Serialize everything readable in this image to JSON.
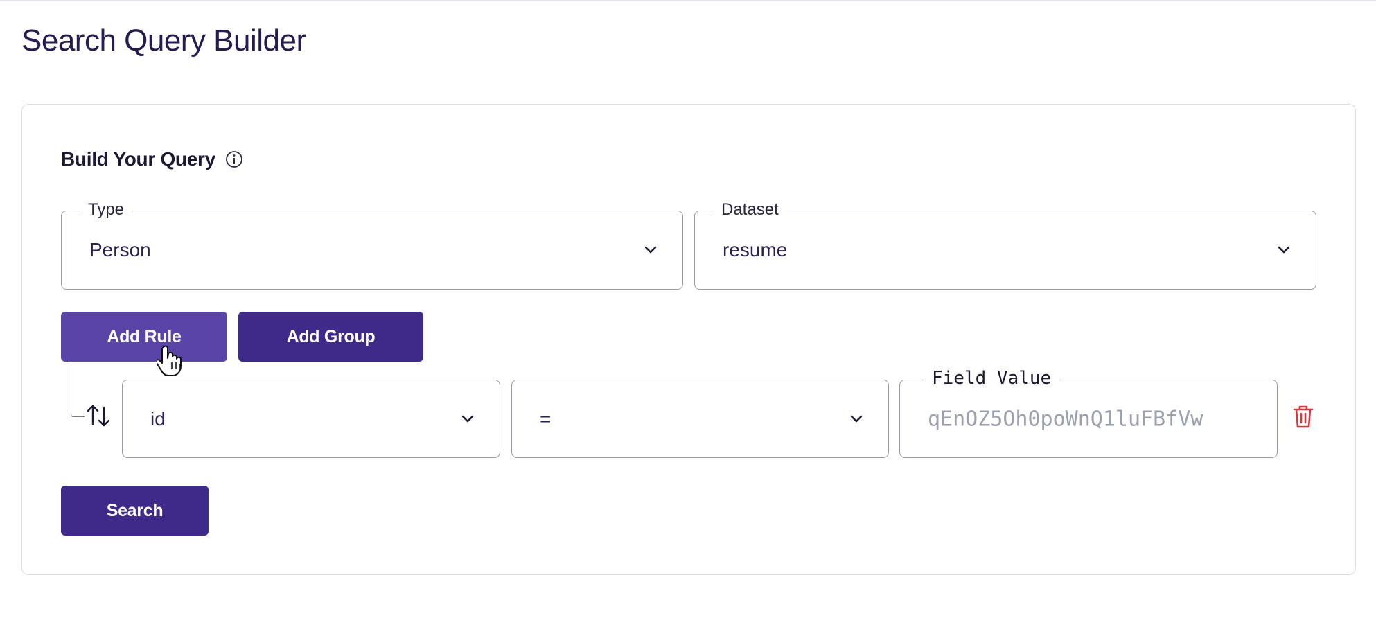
{
  "page": {
    "title": "Search Query Builder"
  },
  "builder": {
    "section_title": "Build Your Query",
    "type_field": {
      "label": "Type",
      "value": "Person"
    },
    "dataset_field": {
      "label": "Dataset",
      "value": "resume"
    },
    "add_rule_label": "Add Rule",
    "add_group_label": "Add Group",
    "rule": {
      "field": "id",
      "operator": "=",
      "value_label": "Field Value",
      "value_placeholder": "qEnOZ5Oh0poWnQ1luFBfVw"
    },
    "search_label": "Search"
  },
  "icons": {
    "info": "info-circle-icon",
    "chevron": "chevron-down-icon",
    "sort": "sort-arrows-icon",
    "trash": "trash-icon",
    "cursor": "hand-pointer-cursor"
  },
  "colors": {
    "primary": "#3f2a8a",
    "primary_hover": "#5b44a7",
    "danger": "#d9363e",
    "title": "#261a50"
  }
}
